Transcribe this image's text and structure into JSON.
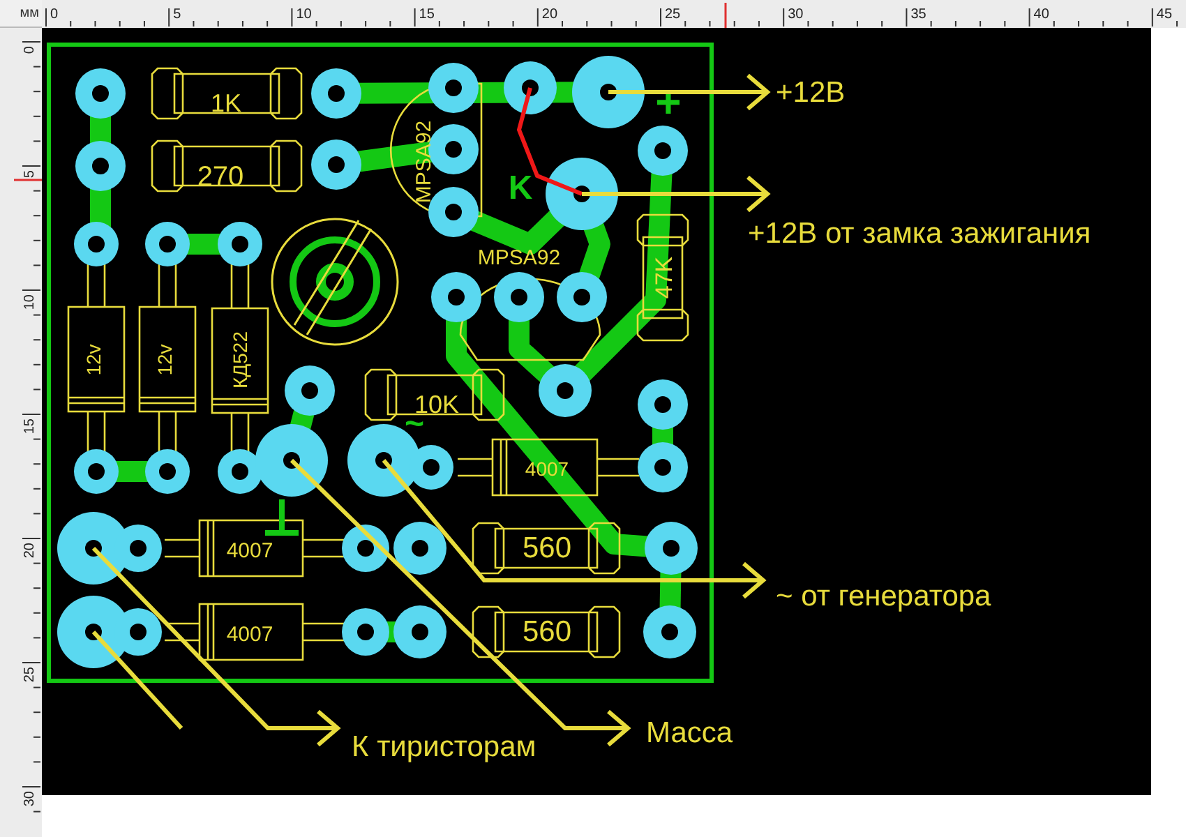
{
  "ruler": {
    "unit": "мм",
    "top_labels": [
      "0",
      "5",
      "10",
      "15",
      "20",
      "25",
      "30",
      "35",
      "40",
      "45"
    ],
    "left_labels": [
      "0",
      "5",
      "10",
      "15",
      "20",
      "25",
      "30"
    ]
  },
  "board": {
    "component_labels": [
      {
        "text": "1K"
      },
      {
        "text": "270"
      },
      {
        "text": "MPSA92"
      },
      {
        "text": "K"
      },
      {
        "text": "+"
      },
      {
        "text": "MPSA92"
      },
      {
        "text": "12v"
      },
      {
        "text": "12v"
      },
      {
        "text": "КД522"
      },
      {
        "text": "47K"
      },
      {
        "text": "10K"
      },
      {
        "text": "~"
      },
      {
        "text": "4007"
      },
      {
        "text": "4007"
      },
      {
        "text": "560"
      },
      {
        "text": "4007"
      },
      {
        "text": "560"
      }
    ],
    "annotations": [
      {
        "text": "+12В"
      },
      {
        "text": "+12В от замка зажигания"
      },
      {
        "text": "~ от генератора"
      },
      {
        "text": "Масса"
      },
      {
        "text": "К тиристорам"
      }
    ]
  }
}
